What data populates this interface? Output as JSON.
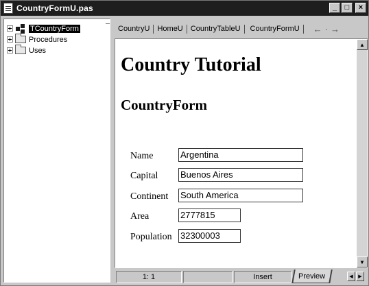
{
  "window": {
    "title": "CountryFormU.pas"
  },
  "title_buttons": {
    "minimize": "_",
    "maximize": "□",
    "close": "×"
  },
  "tree": {
    "items": [
      {
        "label": "TCountryForm",
        "icon": "class-icon",
        "selected": true
      },
      {
        "label": "Procedures",
        "icon": "folder-icon"
      },
      {
        "label": "Uses",
        "icon": "folder-icon"
      }
    ]
  },
  "tabs": {
    "items": [
      "CountryU",
      "HomeU",
      "CountryTableU",
      "CountryFormU"
    ],
    "active": "CountryFormU",
    "nav_back": "←",
    "nav_forward": "→"
  },
  "document": {
    "heading1": "Country Tutorial",
    "heading2": "CountryForm",
    "fields": [
      {
        "label": "Name",
        "value": "Argentina"
      },
      {
        "label": "Capital",
        "value": "Buenos Aires"
      },
      {
        "label": "Continent",
        "value": "South America"
      },
      {
        "label": "Area",
        "value": "2777815"
      },
      {
        "label": "Population",
        "value": "32300003"
      }
    ]
  },
  "status": {
    "position": "1:  1",
    "mode": "Insert",
    "view_tab": "Preview"
  }
}
